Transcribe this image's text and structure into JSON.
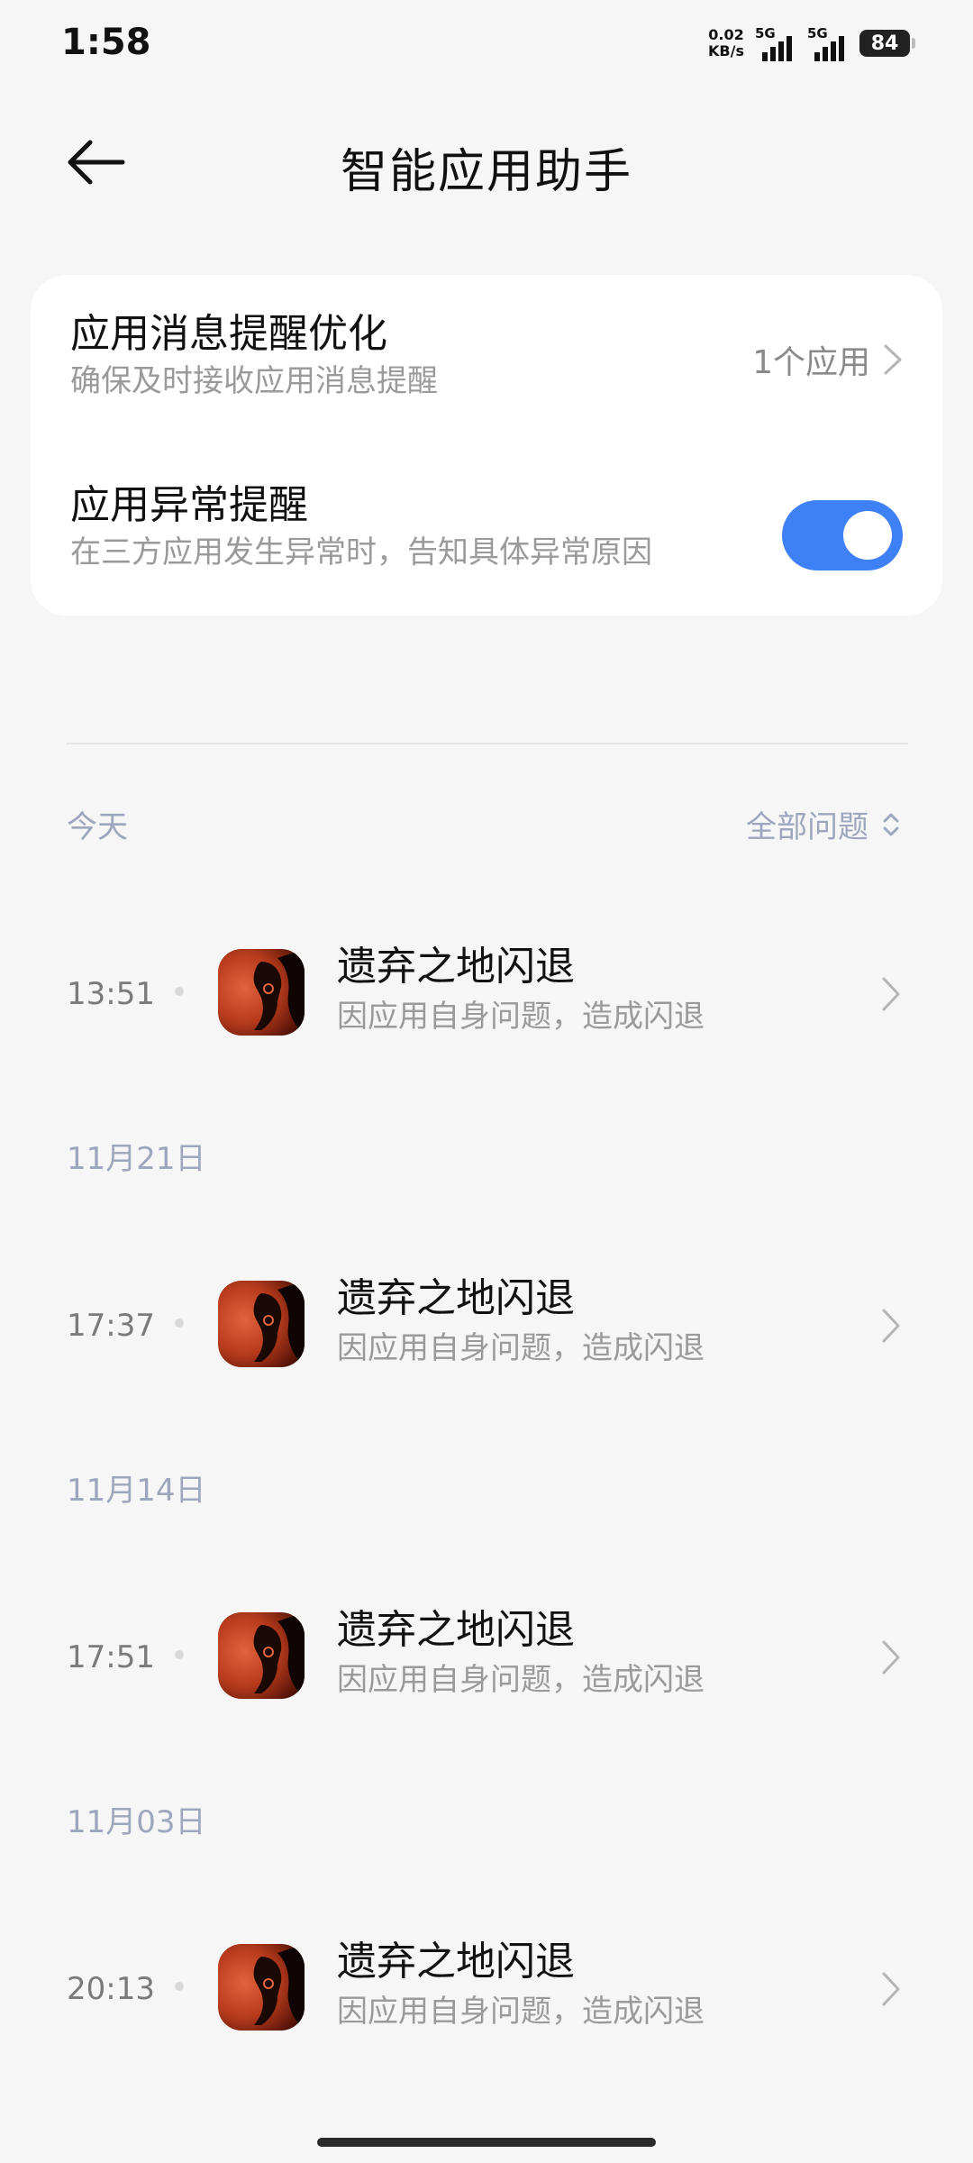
{
  "status_bar": {
    "time": "1:58",
    "net_speed_value": "0.02",
    "net_speed_unit": "KB/s",
    "sim1_tag": "5G",
    "sim2_tag": "5G",
    "battery": "84"
  },
  "header": {
    "title": "智能应用助手"
  },
  "settings": {
    "notify_opt": {
      "title": "应用消息提醒优化",
      "subtitle": "确保及时接收应用消息提醒",
      "count_label": "1个应用"
    },
    "abnormal": {
      "title": "应用异常提醒",
      "subtitle": "在三方应用发生异常时，告知具体异常原因",
      "enabled": true
    }
  },
  "filter": {
    "label": "全部问题"
  },
  "sections": [
    {
      "date": "今天",
      "events": [
        {
          "time": "13:51",
          "title": "遗弃之地闪退",
          "subtitle": "因应用自身问题，造成闪退"
        }
      ]
    },
    {
      "date": "11月21日",
      "events": [
        {
          "time": "17:37",
          "title": "遗弃之地闪退",
          "subtitle": "因应用自身问题，造成闪退"
        }
      ]
    },
    {
      "date": "11月14日",
      "events": [
        {
          "time": "17:51",
          "title": "遗弃之地闪退",
          "subtitle": "因应用自身问题，造成闪退"
        }
      ]
    },
    {
      "date": "11月03日",
      "events": [
        {
          "time": "20:13",
          "title": "遗弃之地闪退",
          "subtitle": "因应用自身问题，造成闪退"
        }
      ]
    }
  ],
  "colors": {
    "accent": "#3e80f6",
    "background": "#f6f6f6",
    "date_text": "#9da6bd"
  },
  "icons": {
    "back": "arrow-left-icon",
    "chevron": "chevron-right-icon",
    "sort": "sort-updown-icon",
    "app": "game-app-icon"
  }
}
